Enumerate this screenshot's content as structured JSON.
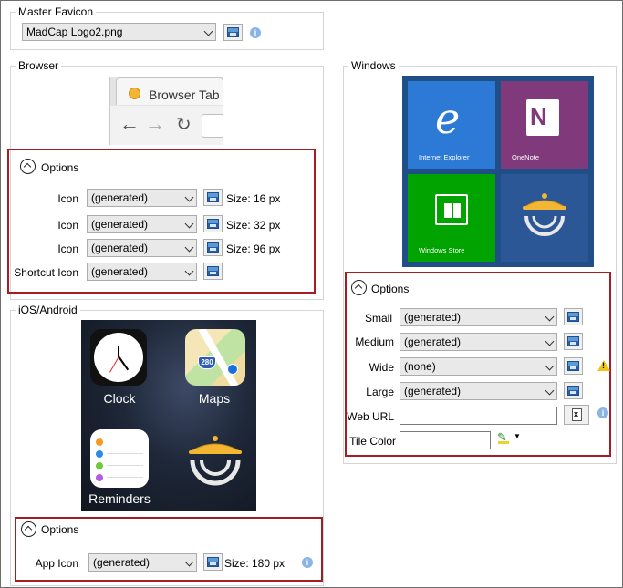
{
  "master_favicon": {
    "title": "Master Favicon",
    "file": "MadCap Logo2.png"
  },
  "browser": {
    "title": "Browser",
    "preview_tab_label": "Browser Tab",
    "options_label": "Options",
    "rows": [
      {
        "label": "Icon",
        "value": "(generated)",
        "size": "Size: 16 px"
      },
      {
        "label": "Icon",
        "value": "(generated)",
        "size": "Size: 32 px"
      },
      {
        "label": "Icon",
        "value": "(generated)",
        "size": "Size: 96 px"
      },
      {
        "label": "Shortcut Icon",
        "value": "(generated)",
        "size": ""
      }
    ]
  },
  "ios": {
    "title": "iOS/Android",
    "apps": {
      "clock": "Clock",
      "maps": "Maps",
      "maps_badge": "280",
      "reminders": "Reminders"
    },
    "options_label": "Options",
    "app_icon_label": "App Icon",
    "app_icon_value": "(generated)",
    "app_icon_size": "Size: 180 px"
  },
  "windows": {
    "title": "Windows",
    "tiles": {
      "ie": "Internet Explorer",
      "onenote": "OneNote",
      "store": "Windows Store"
    },
    "options_label": "Options",
    "rows": [
      {
        "label": "Small",
        "value": "(generated)"
      },
      {
        "label": "Medium",
        "value": "(generated)"
      },
      {
        "label": "Wide",
        "value": "(none)"
      },
      {
        "label": "Large",
        "value": "(generated)"
      }
    ],
    "web_url_label": "Web URL",
    "web_url_value": "",
    "tile_color_label": "Tile Color",
    "tile_color_value": ""
  },
  "colors": {
    "highlight_border": "#a31e22",
    "tile_blue": "#2d7ad6",
    "tile_purple": "#80397b",
    "tile_green": "#00a300",
    "tile_dark_blue": "#2b5797"
  },
  "icons": {
    "browse": "image-browse-icon",
    "info": "info-icon",
    "warning": "warning-icon",
    "options_toggle": "collapse-up-icon"
  }
}
